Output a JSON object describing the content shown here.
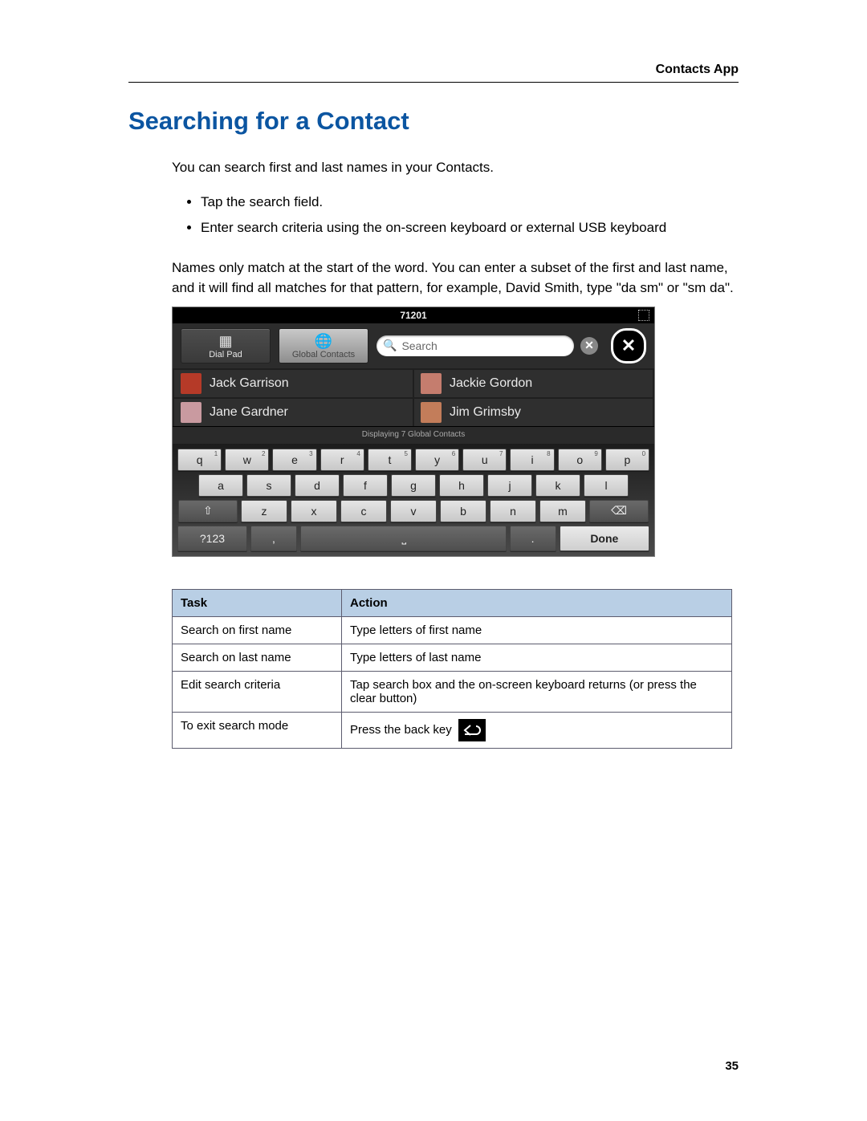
{
  "header": {
    "section": "Contacts App"
  },
  "title": "Searching for a Contact",
  "intro": "You can search first and last names in your Contacts.",
  "bullets": [
    "Tap the search field.",
    "Enter search criteria using the on-screen keyboard or external USB keyboard"
  ],
  "note": "Names only match at the start of the word. You can enter a subset of the first and last name, and it will find all matches for that pattern, for example, David Smith, type \"da sm\" or \"sm da\".",
  "screenshot": {
    "status_number": "71201",
    "tabs": {
      "dialpad": "Dial Pad",
      "global": "Global Contacts"
    },
    "search_placeholder": "Search",
    "contacts": [
      {
        "name": "Jack Garrison",
        "color": "#b53a28"
      },
      {
        "name": "Jackie Gordon",
        "color": "#c57d6e"
      },
      {
        "name": "Jane Gardner",
        "color": "#c99aa0"
      },
      {
        "name": "Jim Grimsby",
        "color": "#c37d5a"
      }
    ],
    "sublabel": "Displaying 7 Global Contacts",
    "keyboard": {
      "row1": [
        {
          "k": "q",
          "s": "1"
        },
        {
          "k": "w",
          "s": "2"
        },
        {
          "k": "e",
          "s": "3"
        },
        {
          "k": "r",
          "s": "4"
        },
        {
          "k": "t",
          "s": "5"
        },
        {
          "k": "y",
          "s": "6"
        },
        {
          "k": "u",
          "s": "7"
        },
        {
          "k": "i",
          "s": "8"
        },
        {
          "k": "o",
          "s": "9"
        },
        {
          "k": "p",
          "s": "0"
        }
      ],
      "row2": [
        "a",
        "s",
        "d",
        "f",
        "g",
        "h",
        "j",
        "k",
        "l"
      ],
      "row3": [
        "z",
        "x",
        "c",
        "v",
        "b",
        "n",
        "m"
      ],
      "symkey": "?123",
      "done": "Done"
    }
  },
  "table": {
    "head": {
      "task": "Task",
      "action": "Action"
    },
    "rows": [
      {
        "task": "Search on first name",
        "action": "Type letters of first name"
      },
      {
        "task": "Search on last name",
        "action": "Type letters of last name"
      },
      {
        "task": "Edit search criteria",
        "action": "Tap search box and the on-screen keyboard returns (or press the clear button)"
      },
      {
        "task": "To exit search mode",
        "action": "Press the back key"
      }
    ]
  },
  "page_number": "35"
}
